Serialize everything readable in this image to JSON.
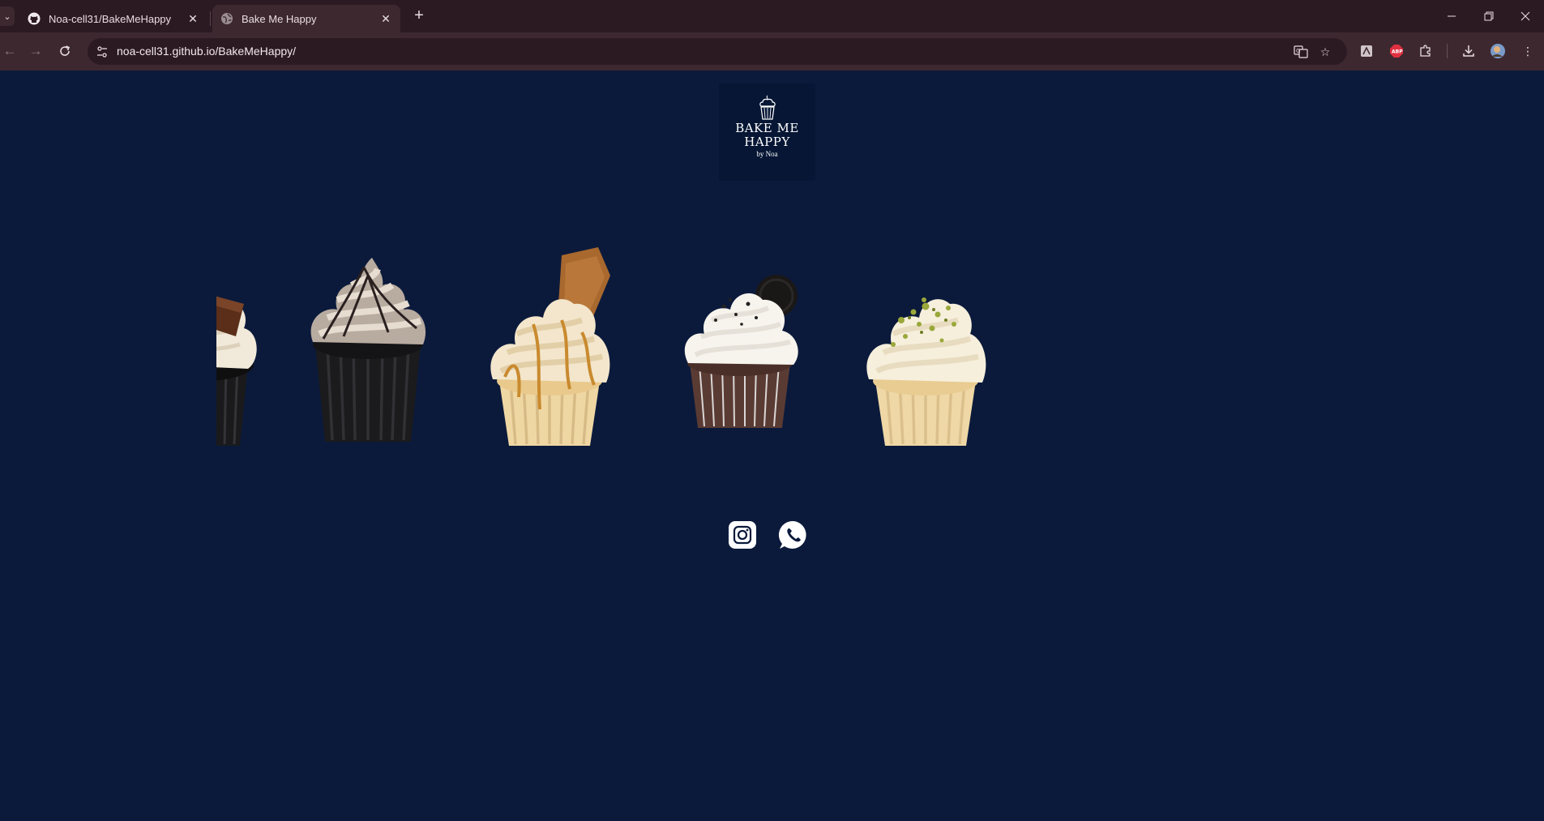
{
  "browser": {
    "tabs": [
      {
        "title": "Noa-cell31/BakeMeHappy",
        "favicon": "github-icon"
      },
      {
        "title": "Bake Me Happy",
        "favicon": "globe-icon",
        "active": true
      }
    ],
    "url": "noa-cell31.github.io/BakeMeHappy/"
  },
  "page": {
    "background": "#0b1a3b",
    "logo": {
      "line1": "BAKE ME",
      "line2": "HAPPY",
      "byline": "by Noa"
    },
    "carousel": {
      "items": [
        {
          "name": "chocolate-bar-cupcake"
        },
        {
          "name": "chocolate-swirl-cupcake"
        },
        {
          "name": "lotus-biscoff-cupcake"
        },
        {
          "name": "oreo-cupcake"
        },
        {
          "name": "pistachio-cupcake"
        }
      ]
    },
    "social": [
      {
        "name": "instagram-icon"
      },
      {
        "name": "whatsapp-icon"
      }
    ]
  }
}
